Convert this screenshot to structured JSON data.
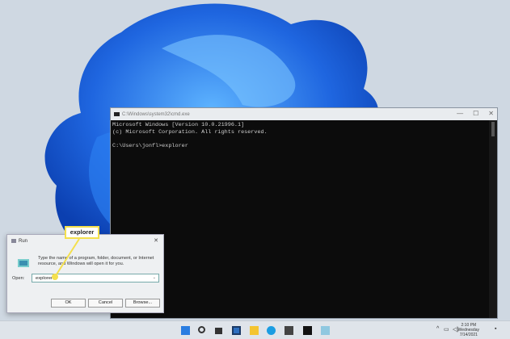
{
  "cmd": {
    "title": "C:\\Windows\\system32\\cmd.exe",
    "lines": [
      "Microsoft Windows [Version 10.0.21996.1]",
      "(c) Microsoft Corporation. All rights reserved.",
      "",
      "C:\\Users\\jonfl>explorer"
    ],
    "controls": [
      "—",
      "☐",
      "✕"
    ]
  },
  "run": {
    "title": "Run",
    "description": "Type the name of a program, folder, document, or Internet resource, and Windows will open it for you.",
    "open_label": "Open:",
    "input_value": "explorer",
    "ok": "OK",
    "cancel": "Cancel",
    "browse": "Browse...",
    "close": "✕"
  },
  "callout": {
    "text": "explorer",
    "color": "#f4e04d"
  },
  "taskbar": {
    "icons": [
      "windows-start",
      "search",
      "task-view",
      "widgets",
      "file-explorer",
      "edge",
      "store",
      "terminal",
      "run"
    ],
    "time": "2:10 PM",
    "day": "Wednesday",
    "date": "7/14/2021"
  }
}
